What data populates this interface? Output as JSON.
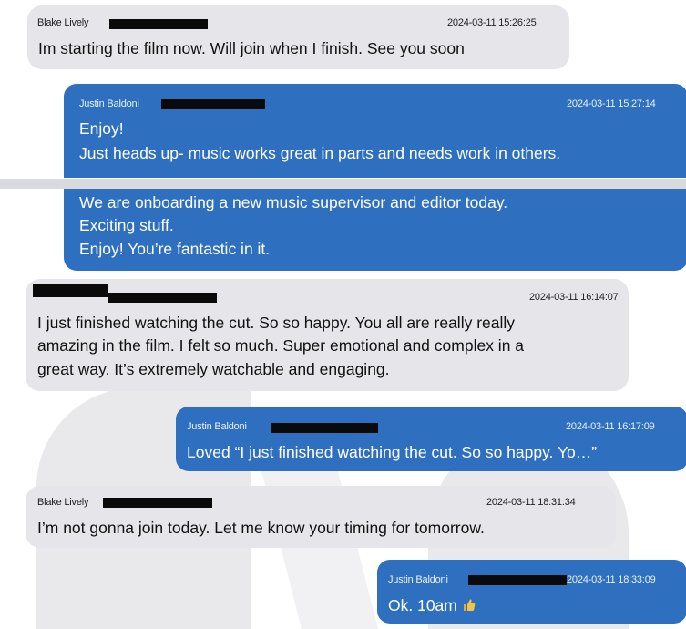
{
  "messages": [
    {
      "sender": "Blake Lively",
      "time": "2024-03-11 15:26:25",
      "lines": [
        "Im starting the film now. Will join when I finish. See you soon"
      ]
    },
    {
      "sender": "Justin Baldoni",
      "time": "2024-03-11 15:27:14",
      "lines": [
        "Enjoy!",
        "Just heads up- music works great in parts and needs work in others."
      ]
    },
    {
      "sender": "",
      "time": "",
      "lines": [
        "We are onboarding a new music supervisor and editor today.",
        "Exciting stuff.",
        "Enjoy! You’re fantastic in it."
      ]
    },
    {
      "sender": "",
      "time": "2024-03-11 16:14:07",
      "lines": [
        "I just finished watching the cut. So so happy. You all are really really",
        "amazing in the film. I felt so much. Super emotional and complex in a",
        "great way. It’s extremely watchable and engaging."
      ]
    },
    {
      "sender": "Justin Baldoni",
      "time": "2024-03-11 16:17:09",
      "lines": [
        "Loved “I just finished watching the cut. So so happy. Yo…”"
      ]
    },
    {
      "sender": "Blake Lively",
      "time": "2024-03-11 18:31:34",
      "lines": [
        "I’m not gonna join today. Let me know your timing for tomorrow."
      ]
    },
    {
      "sender": "Justin Baldoni",
      "time": "2024-03-11 18:33:09",
      "lines": [
        "Ok. 10am"
      ],
      "emoji": "thumbs-up-icon"
    }
  ],
  "colors": {
    "sent": "#2f6fbf",
    "received": "#e6e6ea",
    "redaction": "#0a0a0a"
  }
}
